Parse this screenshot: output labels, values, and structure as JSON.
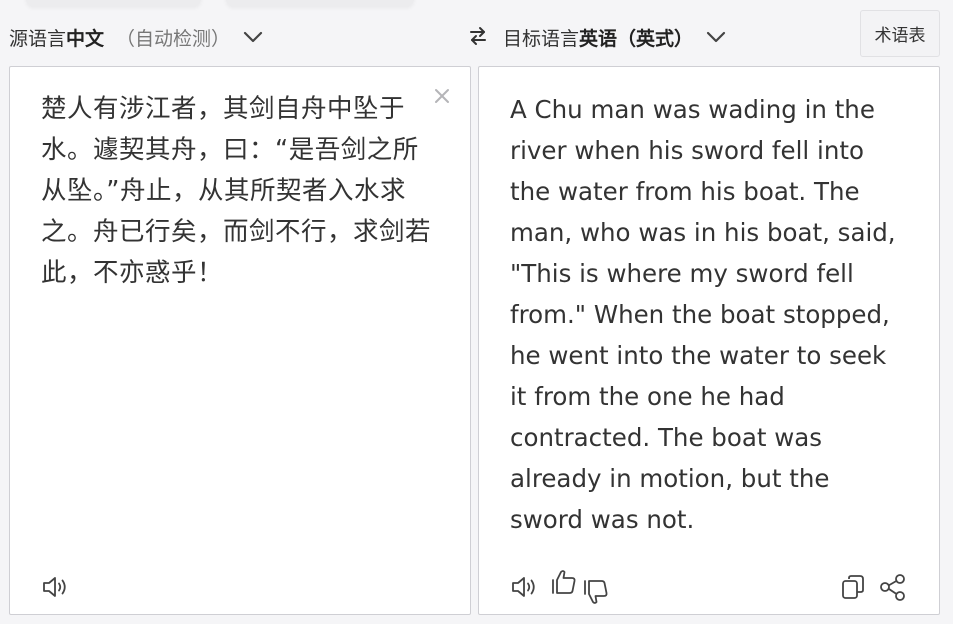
{
  "header": {
    "source_lang": {
      "prefix": "源语言",
      "selected": "中文",
      "detect": "（自动检测）"
    },
    "target_lang": {
      "prefix": "目标语言",
      "selected": "英语（英式）"
    },
    "glossary_label": "术语表"
  },
  "source": {
    "text": "楚人有涉江者，其剑自舟中坠于水。遽契其舟，曰：“是吾剑之所从坠。”舟止，从其所契者入水求之。舟已行矣，而剑不行，求剑若此，不亦惑乎！"
  },
  "target": {
    "text": "A Chu man was wading in the river when his sword fell into the water from his boat. The man, who was in his boat, said, \"This is where my sword fell from.\" When the boat stopped, he went into the water to seek it from the one he had contracted. The boat was already in motion, but the sword was not."
  },
  "icons": {
    "swap": "swap-arrows-icon",
    "clear": "close-icon",
    "source_speaker": "speaker-icon",
    "target_speaker": "speaker-icon",
    "thumbs_up": "thumbs-up-icon",
    "thumbs_down": "thumbs-down-icon",
    "copy": "copy-icon",
    "share": "share-icon"
  },
  "colors": {
    "page_bg": "#f5f5f7",
    "panel_bg": "#ffffff",
    "panel_border": "#cfcfd4",
    "text": "#333333",
    "icon": "#444444"
  }
}
